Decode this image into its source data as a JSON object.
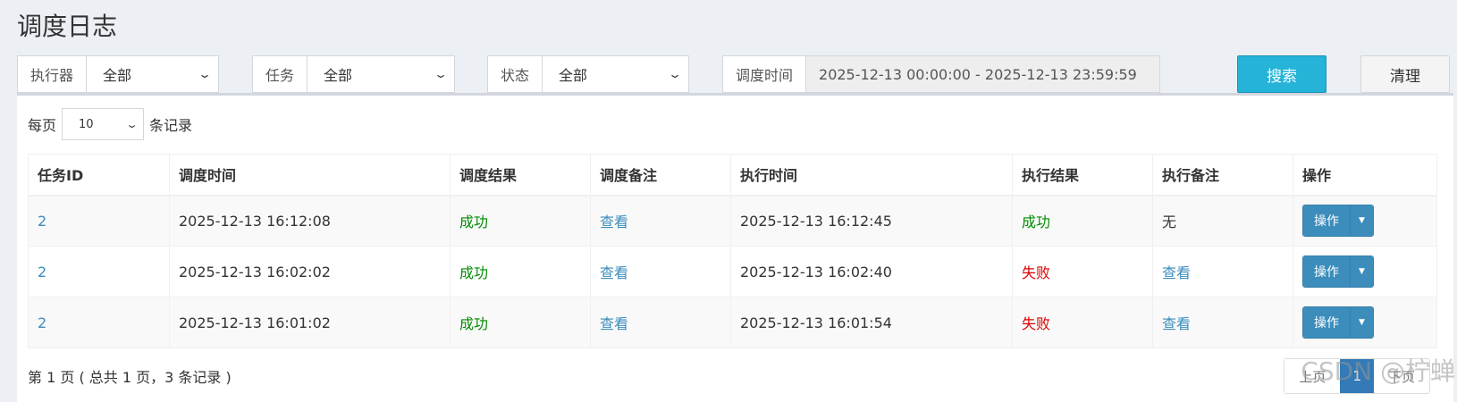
{
  "page": {
    "title": "调度日志"
  },
  "filters": {
    "executor": {
      "label": "执行器",
      "value": "全部"
    },
    "job": {
      "label": "任务",
      "value": "全部"
    },
    "status": {
      "label": "状态",
      "value": "全部"
    },
    "time": {
      "label": "调度时间",
      "value": "2025-12-13 00:00:00 - 2025-12-13 23:59:59"
    },
    "search_label": "搜索",
    "clear_label": "清理"
  },
  "page_size": {
    "prefix": "每页",
    "value": "10",
    "suffix": "条记录"
  },
  "table": {
    "headers": [
      "任务ID",
      "调度时间",
      "调度结果",
      "调度备注",
      "执行时间",
      "执行结果",
      "执行备注",
      "操作"
    ],
    "rows": [
      {
        "id": "2",
        "trigger_time": "2025-12-13 16:12:08",
        "trigger_result": "成功",
        "trigger_msg": "查看",
        "handle_time": "2025-12-13 16:12:45",
        "handle_result": "成功",
        "handle_msg": "无",
        "action": "操作"
      },
      {
        "id": "2",
        "trigger_time": "2025-12-13 16:02:02",
        "trigger_result": "成功",
        "trigger_msg": "查看",
        "handle_time": "2025-12-13 16:02:40",
        "handle_result": "失败",
        "handle_msg": "查看",
        "action": "操作"
      },
      {
        "id": "2",
        "trigger_time": "2025-12-13 16:01:02",
        "trigger_result": "成功",
        "trigger_msg": "查看",
        "handle_time": "2025-12-13 16:01:54",
        "handle_result": "失败",
        "handle_msg": "查看",
        "action": "操作"
      }
    ]
  },
  "footer": {
    "info": "第 1 页 ( 总共 1 页，3 条记录 )",
    "prev": "上页",
    "current": "1",
    "next": "下页"
  },
  "watermark": "CSDN @柠蝉",
  "colors": {
    "primary": "#3c8dbc",
    "search_button": "#25b3d8",
    "success": "#008d00",
    "failure": "#dd0000"
  }
}
